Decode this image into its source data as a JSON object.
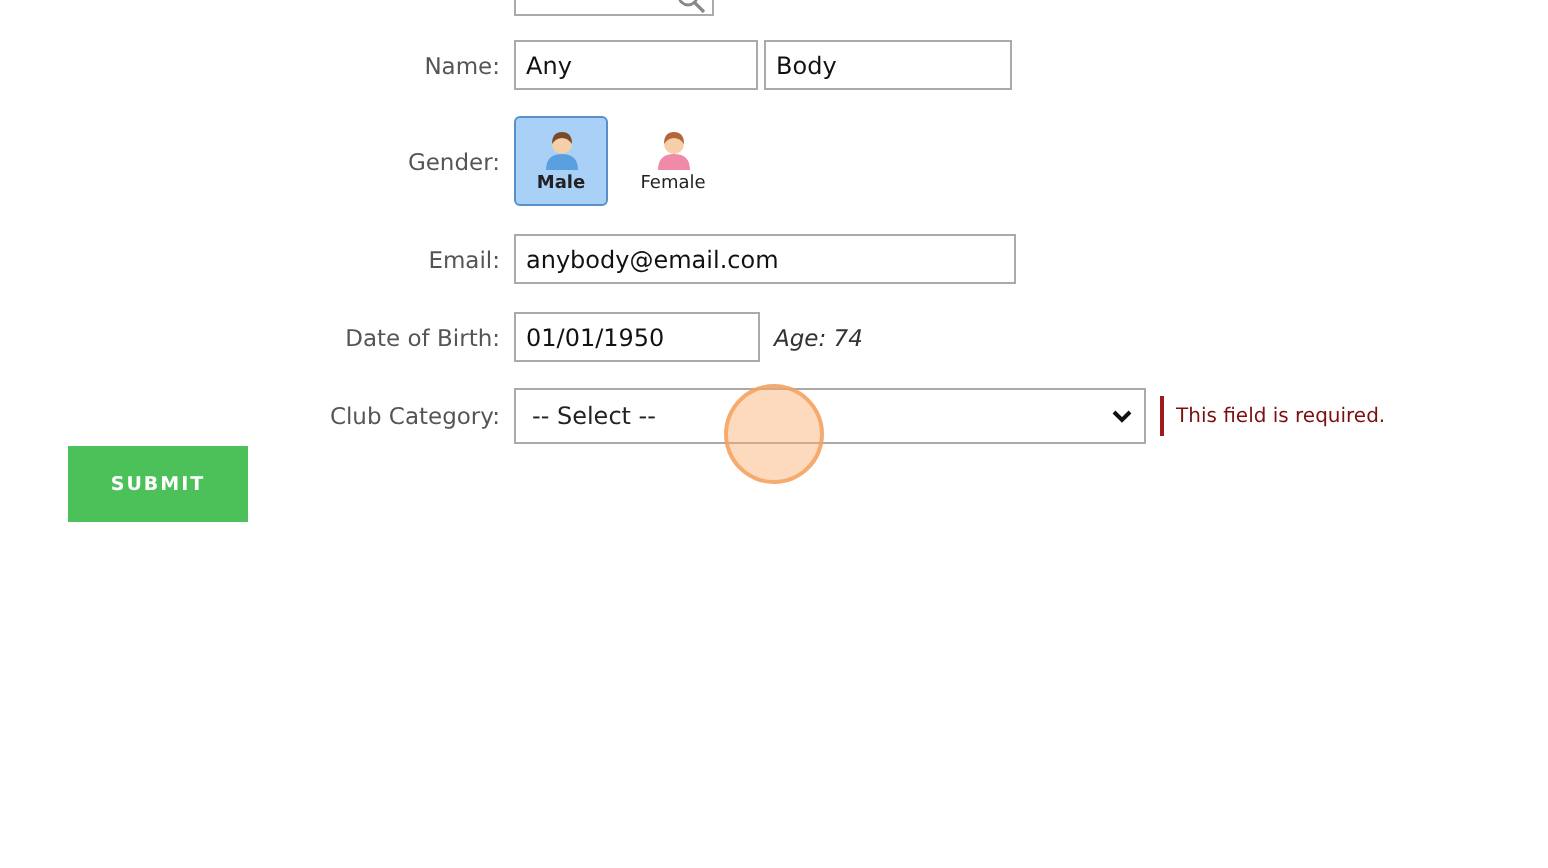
{
  "form": {
    "name": {
      "label": "Name:",
      "first": "Any",
      "last": "Body"
    },
    "gender": {
      "label": "Gender:",
      "options": [
        {
          "label": "Male",
          "kind": "male",
          "selected": true
        },
        {
          "label": "Female",
          "kind": "female",
          "selected": false
        }
      ]
    },
    "email": {
      "label": "Email:",
      "value": "anybody@email.com"
    },
    "date_of_birth": {
      "label": "Date of Birth:",
      "value": "01/01/1950",
      "age": "Age: 74"
    },
    "club_category": {
      "label": "Club Category:",
      "value": "-- Select --",
      "error": "This field is required."
    },
    "submit": "SUBMIT"
  }
}
